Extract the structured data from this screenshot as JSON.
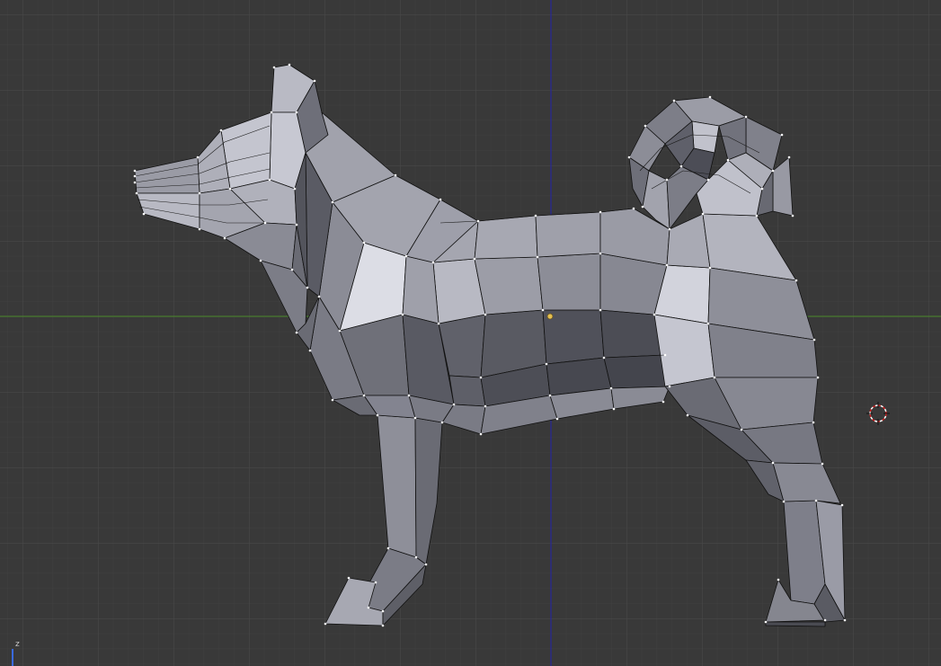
{
  "viewport": {
    "name": "3D View",
    "background_color": "#393939",
    "grid": {
      "minor_color": "#404040",
      "major_color": "#4b4b4b",
      "x_axis_color": "#4a8a2a",
      "z_axis_color": "#2222aa"
    },
    "mesh": {
      "object": "dog",
      "mode": "edit",
      "wire_color": "#000000",
      "vertex_color": "#ffffff"
    },
    "origin_color": "#e6c050",
    "cursor_color": "#cc2222"
  },
  "axis_gizmo": {
    "label": "z",
    "color": "#3a6ae0"
  }
}
